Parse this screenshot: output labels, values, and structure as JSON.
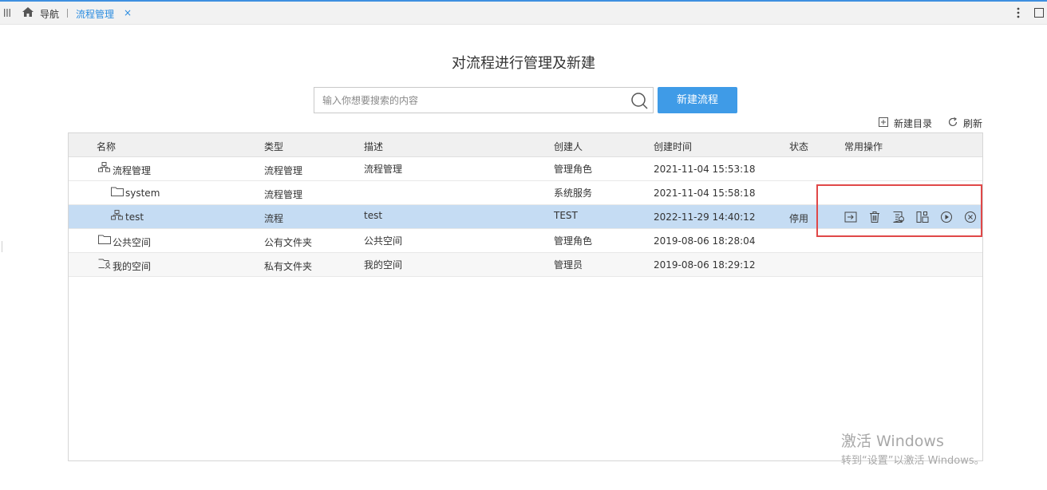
{
  "tabbar": {
    "nav_label": "导航",
    "active_tab": "流程管理",
    "close_glyph": "×"
  },
  "page": {
    "title": "对流程进行管理及新建"
  },
  "search": {
    "placeholder": "输入你想要搜索的内容",
    "value": ""
  },
  "toolbar": {
    "new_flow": "新建流程",
    "new_dir": "新建目录",
    "refresh": "刷新"
  },
  "table": {
    "columns": [
      "名称",
      "类型",
      "描述",
      "创建人",
      "创建时间",
      "状态",
      "常用操作"
    ],
    "rows": [
      {
        "icon": "flow-icon",
        "name": "流程管理",
        "type": "流程管理",
        "desc": "流程管理",
        "creator": "管理角色",
        "time": "2021-11-04 15:53:18",
        "status": ""
      },
      {
        "icon": "folder-icon",
        "name": "system",
        "type": "流程管理",
        "desc": "",
        "creator": "系统服务",
        "time": "2021-11-04 15:58:18",
        "status": ""
      },
      {
        "icon": "flow-icon",
        "name": "test",
        "type": "流程",
        "desc": "test",
        "creator": "TEST",
        "time": "2022-11-29 14:40:12",
        "status": "停用"
      },
      {
        "icon": "folder-icon",
        "name": "公共空间",
        "type": "公有文件夹",
        "desc": "公共空间",
        "creator": "管理角色",
        "time": "2019-08-06 18:28:04",
        "status": ""
      },
      {
        "icon": "private-folder-icon",
        "name": "我的空间",
        "type": "私有文件夹",
        "desc": "我的空间",
        "creator": "管理员",
        "time": "2019-08-06 18:29:12",
        "status": ""
      }
    ],
    "selected_row": 2,
    "operations": [
      "move-icon",
      "delete-icon",
      "edit-icon",
      "layout-icon",
      "play-icon",
      "cancel-icon"
    ]
  },
  "watermark": {
    "line1": "激活 Windows",
    "line2": "转到“设置”以激活 Windows。"
  },
  "colors": {
    "accent": "#3f9be7",
    "selected_row": "#c5dcf3",
    "highlight": "#e04848"
  }
}
